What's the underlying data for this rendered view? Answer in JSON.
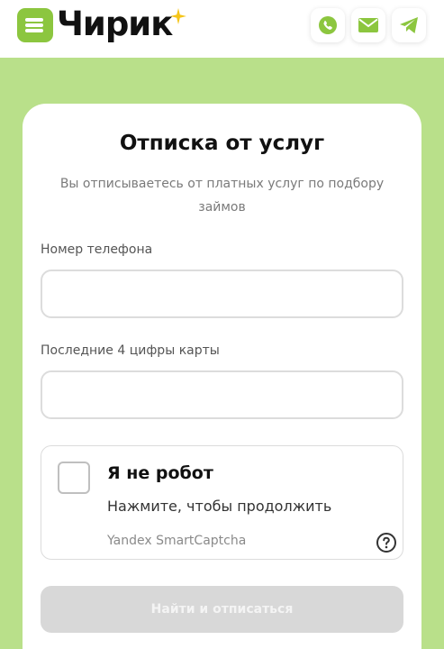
{
  "header": {
    "logo_text": "Чирик",
    "icons": [
      "phone-icon",
      "mail-icon",
      "telegram-icon"
    ],
    "accent_color": "#8cc63f"
  },
  "form": {
    "title": "Отписка от услуг",
    "subtitle": "Вы отписываетесь от платных услуг по подбору займов",
    "phone_label": "Номер телефона",
    "phone_value": "",
    "card_label": "Последние 4 цифры карты",
    "card_value": "",
    "submit_label": "Найти и отписаться"
  },
  "captcha": {
    "title": "Я не робот",
    "subtitle": "Нажмите, чтобы продолжить",
    "brand": "Yandex SmartCaptcha",
    "checked": false
  },
  "colors": {
    "page_background": "#b9e08a",
    "icon_green": "#8cc63f",
    "button_disabled": "#d8d8d8"
  }
}
